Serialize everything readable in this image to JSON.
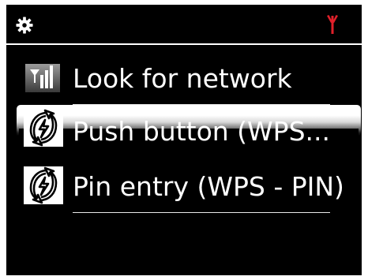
{
  "status_bar": {
    "left_icon": "gear-icon",
    "right_icon": "antenna-icon",
    "antenna_color": "#e0202a"
  },
  "menu": {
    "selected_index": 1,
    "items": [
      {
        "label": "Look for network",
        "icon": "signal-bars-icon"
      },
      {
        "label": "Push button (WPS...",
        "icon": "wps-icon"
      },
      {
        "label": "Pin entry (WPS - PIN)",
        "icon": "wps-icon"
      }
    ]
  }
}
